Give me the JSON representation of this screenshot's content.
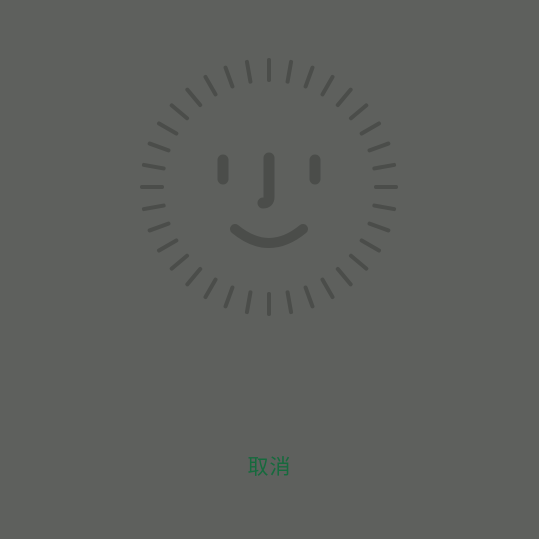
{
  "colors": {
    "background": "#5e605d",
    "face_stroke": "#4b4d4a",
    "accent": "#166a3d"
  },
  "face_scan": {
    "icon": "face-id-icon"
  },
  "cancel_button": {
    "label": "取消"
  }
}
